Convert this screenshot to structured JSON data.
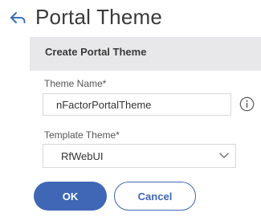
{
  "header": {
    "back_icon": "back-arrow-icon",
    "title": "Portal Theme"
  },
  "panel": {
    "title": "Create Portal Theme",
    "theme_name": {
      "label": "Theme Name*",
      "value": "nFactorPortalTheme",
      "info_icon": "info-circle-icon"
    },
    "template_theme": {
      "label": "Template Theme*",
      "selected": "RfWebUI",
      "chevron_icon": "chevron-down-icon"
    }
  },
  "actions": {
    "ok_label": "OK",
    "cancel_label": "Cancel"
  },
  "colors": {
    "accent": "#3f67b5",
    "panel_header": "#e8e8ea",
    "panel_background": "#f5f5f5"
  }
}
